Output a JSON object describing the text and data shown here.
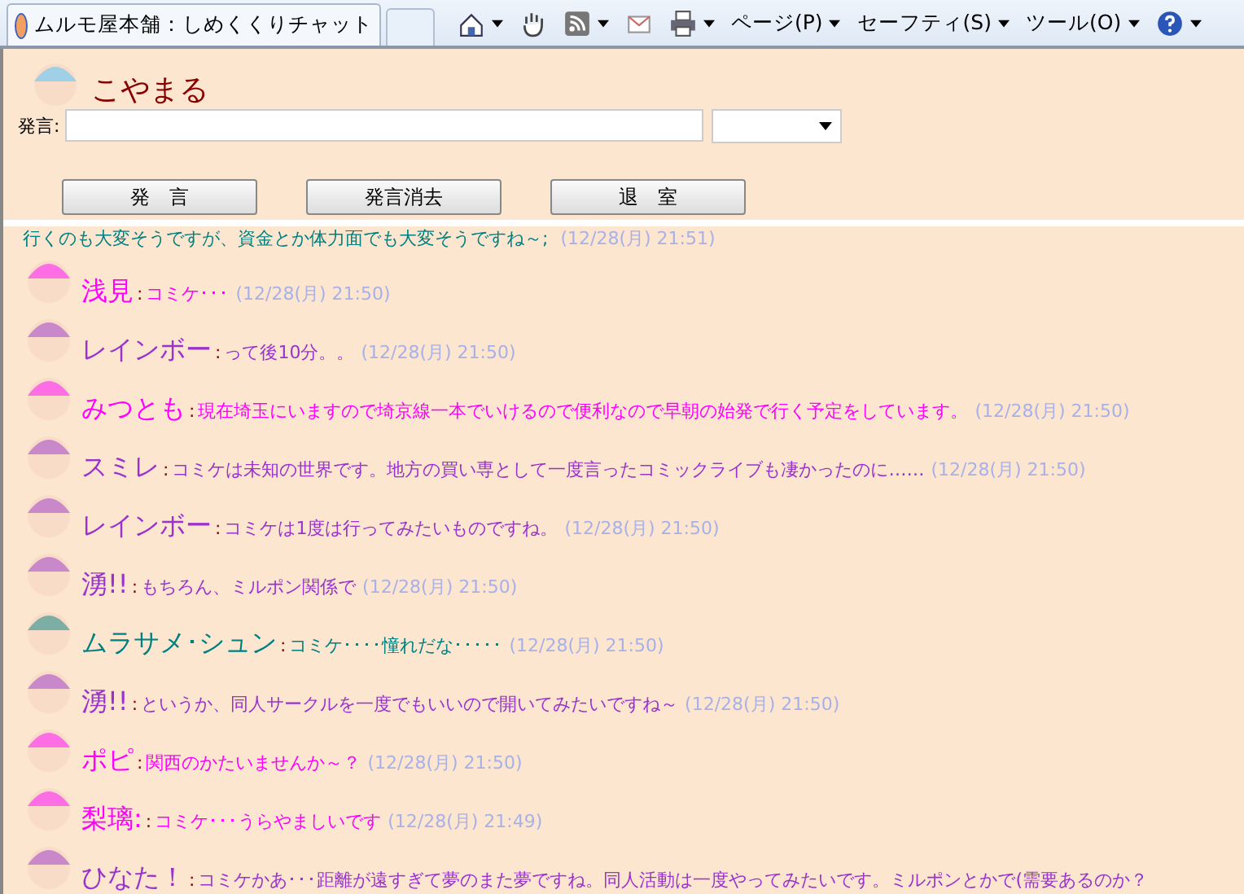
{
  "browser": {
    "tab_title": "ムルモ屋本舗：しめくくりチャット",
    "menus": [
      "ページ(P)",
      "セーフティ(S)",
      "ツール(O)"
    ]
  },
  "user": {
    "name": "こやまる"
  },
  "compose": {
    "label": "発言:",
    "buttons": [
      "発　言",
      "発言消去",
      "退　室"
    ]
  },
  "first_line": {
    "text": "行くのも大変そうですが、資金とか体力面でも大変そうですね～;",
    "time": "(12/28(月) 21:51)"
  },
  "separator": ":",
  "messages": [
    {
      "name": "浅見",
      "color": "#ff00ff",
      "text": "コミケ･･･",
      "time": "(12/28(月) 21:50)"
    },
    {
      "name": "レインボー",
      "color": "#9933cc",
      "text": "って後10分。。",
      "time": "(12/28(月) 21:50)"
    },
    {
      "name": "みつとも",
      "color": "#ff00ff",
      "text": "現在埼玉にいますので埼京線一本でいけるので便利なので早朝の始発で行く予定をしています。",
      "time": "(12/28(月) 21:50)"
    },
    {
      "name": "スミレ",
      "color": "#9933cc",
      "text": "コミケは未知の世界です。地方の買い専として一度言ったコミックライブも凄かったのに……",
      "time": "(12/28(月) 21:50)"
    },
    {
      "name": "レインボー",
      "color": "#9933cc",
      "text": "コミケは1度は行ってみたいものですね。",
      "time": "(12/28(月) 21:50)"
    },
    {
      "name": "湧!!",
      "color": "#9933cc",
      "text": "もちろん、ミルポン関係で",
      "time": "(12/28(月) 21:50)"
    },
    {
      "name": "ムラサメ･シュン",
      "color": "#008080",
      "text": "コミケ････憧れだな･････",
      "time": "(12/28(月) 21:50)"
    },
    {
      "name": "湧!!",
      "color": "#9933cc",
      "text": "というか、同人サークルを一度でもいいので開いてみたいですね～",
      "time": "(12/28(月) 21:50)"
    },
    {
      "name": "ポピ",
      "color": "#ff00ff",
      "text": "関西のかたいませんか～？",
      "time": "(12/28(月) 21:50)"
    },
    {
      "name": "梨璃:",
      "color": "#ff00ff",
      "text": "コミケ･･･うらやましいです",
      "time": "(12/28(月) 21:49)"
    },
    {
      "name": "ひなた！",
      "color": "#9933cc",
      "text": "コミケかあ･･･距離が遠すぎて夢のまた夢ですね。同人活動は一度やってみたいです。ミルポンとかで(需要あるのか？"
    }
  ]
}
